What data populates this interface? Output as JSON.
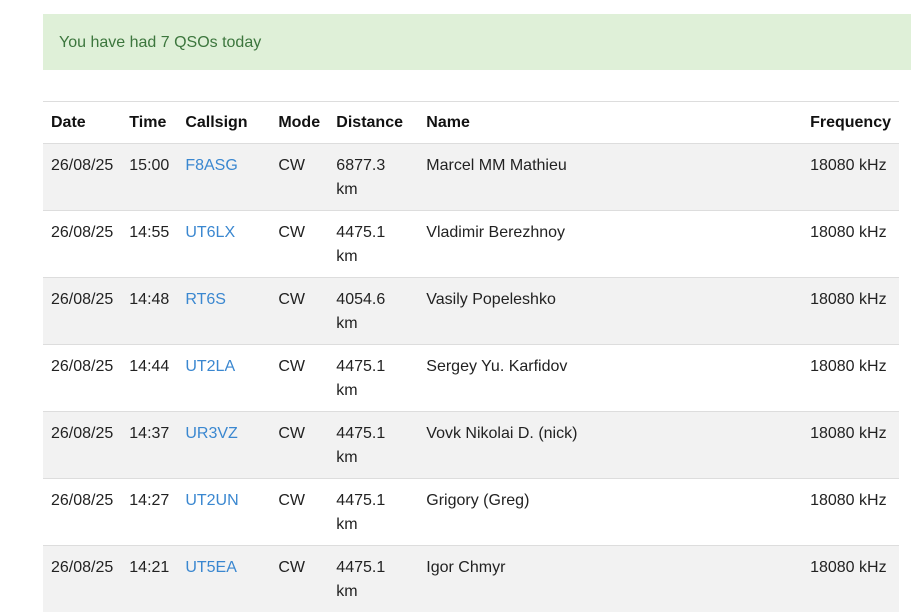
{
  "alert": {
    "message": "You have had 7 QSOs today"
  },
  "table": {
    "headers": {
      "date": "Date",
      "time": "Time",
      "callsign": "Callsign",
      "mode": "Mode",
      "distance": "Distance",
      "name": "Name",
      "frequency": "Frequency"
    },
    "rows": [
      {
        "date": "26/08/25",
        "time": "15:00",
        "callsign": "F8ASG",
        "mode": "CW",
        "distance_value": "6877.3",
        "distance_unit": "km",
        "name": "Marcel MM Mathieu",
        "frequency": "18080 kHz"
      },
      {
        "date": "26/08/25",
        "time": "14:55",
        "callsign": "UT6LX",
        "mode": "CW",
        "distance_value": "4475.1",
        "distance_unit": "km",
        "name": "Vladimir Berezhnoy",
        "frequency": "18080 kHz"
      },
      {
        "date": "26/08/25",
        "time": "14:48",
        "callsign": "RT6S",
        "mode": "CW",
        "distance_value": "4054.6",
        "distance_unit": "km",
        "name": "Vasily Popeleshko",
        "frequency": "18080 kHz"
      },
      {
        "date": "26/08/25",
        "time": "14:44",
        "callsign": "UT2LA",
        "mode": "CW",
        "distance_value": "4475.1",
        "distance_unit": "km",
        "name": "Sergey Yu. Karfidov",
        "frequency": "18080 kHz"
      },
      {
        "date": "26/08/25",
        "time": "14:37",
        "callsign": "UR3VZ",
        "mode": "CW",
        "distance_value": "4475.1",
        "distance_unit": "km",
        "name": "Vovk Nikolai D. (nick)",
        "frequency": "18080 kHz"
      },
      {
        "date": "26/08/25",
        "time": "14:27",
        "callsign": "UT2UN",
        "mode": "CW",
        "distance_value": "4475.1",
        "distance_unit": "km",
        "name": "Grigory (Greg)",
        "frequency": "18080 kHz"
      },
      {
        "date": "26/08/25",
        "time": "14:21",
        "callsign": "UT5EA",
        "mode": "CW",
        "distance_value": "4475.1",
        "distance_unit": "km",
        "name": "Igor Chmyr",
        "frequency": "18080 kHz"
      }
    ]
  },
  "colors": {
    "alert_background": "#dff0d8",
    "alert_text": "#3c763d",
    "link": "#3a87d0",
    "stripe": "#f2f2f2",
    "border": "#dddddd"
  }
}
